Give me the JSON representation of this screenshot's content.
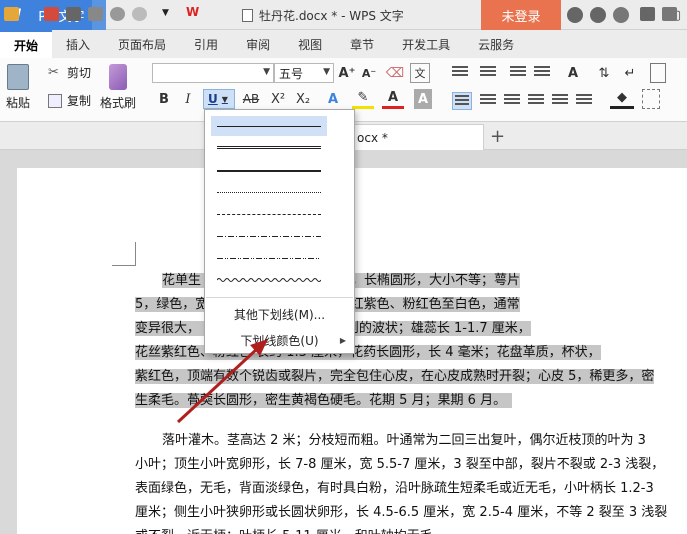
{
  "titlebar": {
    "app_logo": "W",
    "app_name": "WPS 文字",
    "document_title": "牡丹花.docx * - WPS 文字",
    "login_label": "未登录"
  },
  "ribbon_tabs": [
    "开始",
    "插入",
    "页面布局",
    "引用",
    "审阅",
    "视图",
    "章节",
    "开发工具",
    "云服务"
  ],
  "ribbon": {
    "paste_label": "粘贴",
    "cut_label": "剪切",
    "copy_label": "复制",
    "format_painter_label": "格式刷",
    "font_name_value": "",
    "font_size_value": "五号",
    "bold": "B",
    "italic": "I",
    "underline": "U",
    "strikethrough": "AB",
    "superscript": "X²",
    "subscript": "X₂",
    "grow_font": "A⁺",
    "shrink_font": "A⁻",
    "text_effect": "A",
    "font_color": "A",
    "char_shading": "A"
  },
  "doc_tab": {
    "label": "ocx *",
    "add_label": "+"
  },
  "underline_menu": {
    "styles": [
      "single",
      "double",
      "thick",
      "dotted",
      "dashed",
      "dash-dot",
      "dash-dot-dot",
      "wave"
    ],
    "other_label": "其他下划线(M)...",
    "color_label": "下划线颜色(U)"
  },
  "document": {
    "para1_lines": [
      "花单生                      花梗长 4-6 厘米；苞片 5，长椭圆形，大小不等；萼片",
      "5，绿色，宽                   5，或为重瓣，玫瑰色、红紫色、粉红色至白色，通常",
      "变异很大，                    4.2-6 厘米，顶端呈不规则的波状；雄蕊长 1-1.7 厘米，",
      "花丝紫红色、粉红色              长约 1.3 厘米，花药长圆形，长 4 毫米；花盘革质，杯状，",
      "紫红色，顶端有数个锐齿或裂片，完全包住心皮，在心皮成熟时开裂；心皮 5，稀更多，密",
      "生柔毛。蓇葖长圆形，密生黄褐色硬毛。花期 5 月；果期 6 月。"
    ],
    "para2_lines": [
      "落叶灌木。茎高达 2 米；分枝短而粗。叶通常为二回三出复叶，偶尔近枝顶的叶为 3",
      "小叶；顶生小叶宽卵形，长 7-8 厘米，宽 5.5-7 厘米，3 裂至中部，裂片不裂或 2-3 浅裂，",
      "表面绿色，无毛，背面淡绿色，有时具白粉，沿叶脉疏生短柔毛或近无毛，小叶柄长 1.2-3",
      "厘米；侧生小叶狭卵形或长圆状卵形，长 4.5-6.5 厘米，宽 2.5-4 厘米，不等 2 裂至 3 浅裂",
      "或不裂，近无柄；叶柄长 5-11 厘米，和叶轴均无毛。"
    ]
  },
  "colors": {
    "accent": "#3e82dd",
    "login_bg": "#e8734e",
    "selection": "#c6c6c6",
    "arrow": "#b01e1e"
  }
}
